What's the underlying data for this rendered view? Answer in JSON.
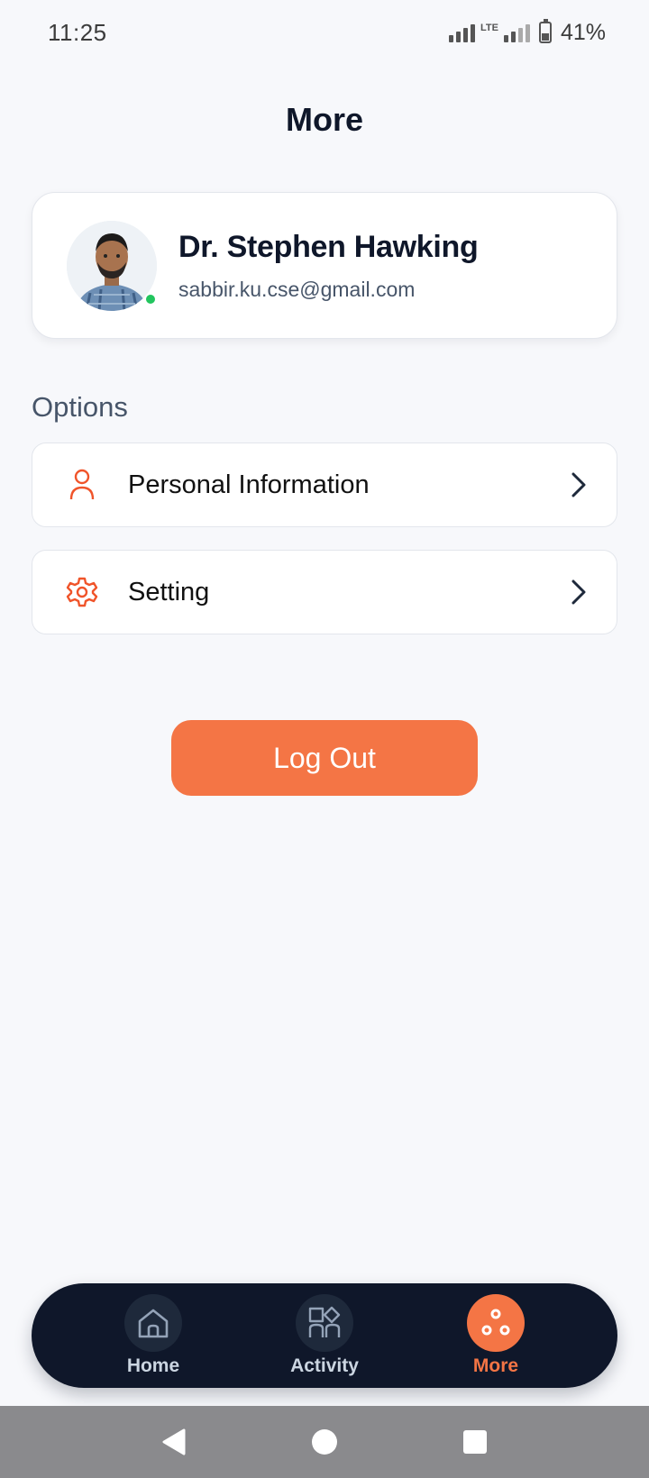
{
  "status": {
    "time": "11:25",
    "network": "LTE",
    "battery": "41%"
  },
  "page": {
    "title": "More"
  },
  "profile": {
    "name": "Dr. Stephen Hawking",
    "email": "sabbir.ku.cse@gmail.com",
    "online": true
  },
  "options": {
    "section_label": "Options",
    "items": [
      {
        "label": "Personal Information",
        "icon": "person-icon"
      },
      {
        "label": "Setting",
        "icon": "gear-icon"
      }
    ]
  },
  "actions": {
    "logout_label": "Log Out"
  },
  "bottom_nav": {
    "items": [
      {
        "label": "Home",
        "icon": "home-icon",
        "active": false
      },
      {
        "label": "Activity",
        "icon": "activity-icon",
        "active": false
      },
      {
        "label": "More",
        "icon": "more-icon",
        "active": true
      }
    ]
  },
  "colors": {
    "accent": "#f47545",
    "nav_background": "#0f172a",
    "online": "#22c55e"
  }
}
